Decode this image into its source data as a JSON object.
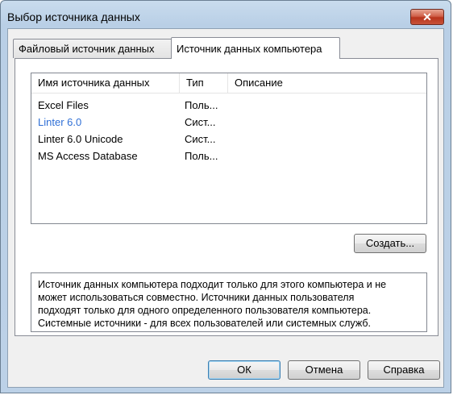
{
  "window": {
    "title": "Выбор источника данных",
    "close_label": "✕"
  },
  "tabs": [
    {
      "label": "Файловый источник данных"
    },
    {
      "label": "Источник данных компьютера"
    }
  ],
  "list": {
    "columns": [
      "Имя источника данных",
      "Тип",
      "Описание"
    ],
    "rows": [
      {
        "name": "Excel Files",
        "type": "Поль...",
        "desc": ""
      },
      {
        "name": "Linter 6.0",
        "type": "Сист...",
        "desc": ""
      },
      {
        "name": "Linter 6.0 Unicode",
        "type": "Сист...",
        "desc": ""
      },
      {
        "name": "MS Access Database",
        "type": "Поль...",
        "desc": ""
      }
    ],
    "selected_name": "Linter 6.0"
  },
  "buttons": {
    "create": "Создать...",
    "ok": "ОК",
    "cancel": "Отмена",
    "help": "Справка"
  },
  "info_text": [
    "Источник данных компьютера подходит только для этого компьютера и не",
    "может использоваться совместно.  Источники данных пользователя",
    "подходят только для одного определенного пользователя компьютера.",
    "Системные источники - для всех пользователей или системных служб."
  ],
  "colors": {
    "accent": "#2f6fd6",
    "frame": "#bcd1e7"
  },
  "icons": {
    "close": "close-icon"
  }
}
